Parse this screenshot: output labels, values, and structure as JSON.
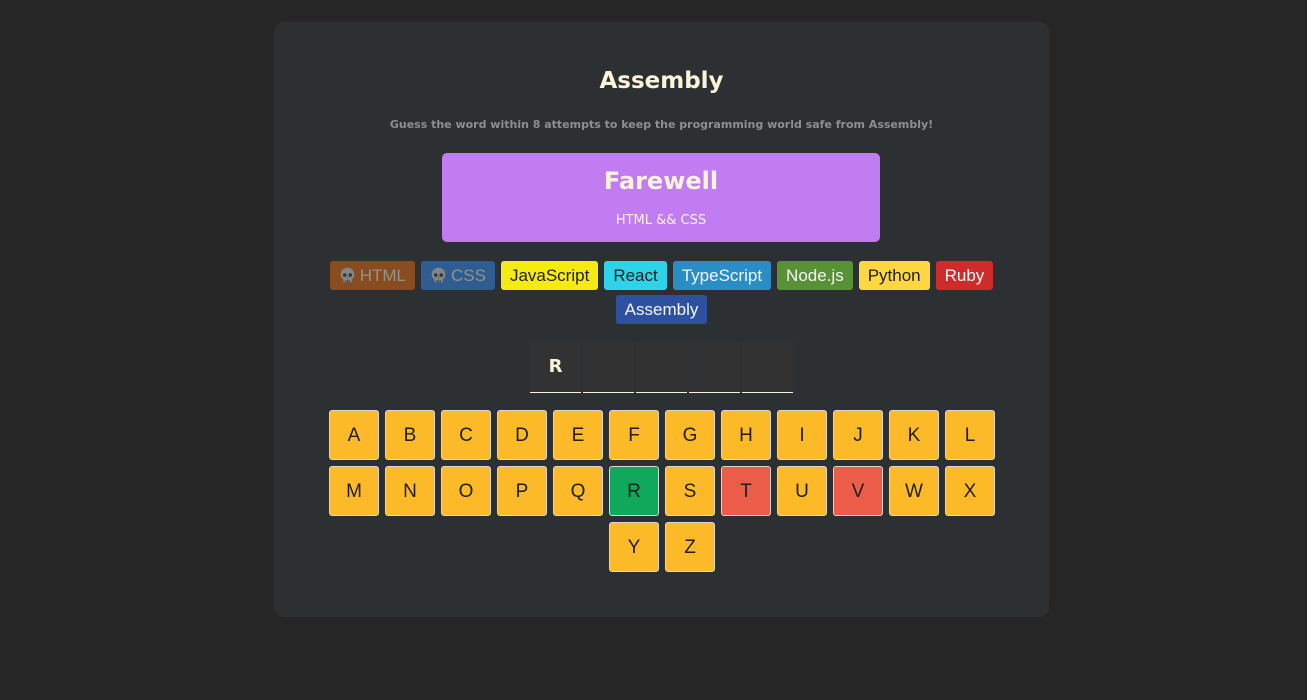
{
  "header": {
    "title": "Assembly",
    "subtitle": "Guess the word within 8 attempts to keep the programming world safe from Assembly!"
  },
  "status": {
    "title": "Farewell",
    "message": "HTML && CSS",
    "color": "#c27cf2"
  },
  "languages": [
    {
      "name": "HTML",
      "bg": "#e2680f",
      "fg": "#f9f4da",
      "lost": true
    },
    {
      "name": "CSS",
      "bg": "#328af1",
      "fg": "#f9f4da",
      "lost": true
    },
    {
      "name": "JavaScript",
      "bg": "#f4eb13",
      "fg": "#1e1e1e",
      "lost": false
    },
    {
      "name": "React",
      "bg": "#2ed3e9",
      "fg": "#1e1e1e",
      "lost": false
    },
    {
      "name": "TypeScript",
      "bg": "#298ec6",
      "fg": "#f5f5f5",
      "lost": false
    },
    {
      "name": "Node.js",
      "bg": "#599137",
      "fg": "#f5f5f5",
      "lost": false
    },
    {
      "name": "Python",
      "bg": "#ffd742",
      "fg": "#1e1e1e",
      "lost": false
    },
    {
      "name": "Ruby",
      "bg": "#d02b2b",
      "fg": "#f5f5f5",
      "lost": false
    },
    {
      "name": "Assembly",
      "bg": "#2d519f",
      "fg": "#f5f5f5",
      "lost": false
    }
  ],
  "word": [
    "R",
    "",
    "",
    "",
    ""
  ],
  "keyboard": {
    "letters": [
      "A",
      "B",
      "C",
      "D",
      "E",
      "F",
      "G",
      "H",
      "I",
      "J",
      "K",
      "L",
      "M",
      "N",
      "O",
      "P",
      "Q",
      "R",
      "S",
      "T",
      "U",
      "V",
      "W",
      "X",
      "Y",
      "Z"
    ],
    "correct": [
      "R"
    ],
    "wrong": [
      "T",
      "V"
    ]
  }
}
